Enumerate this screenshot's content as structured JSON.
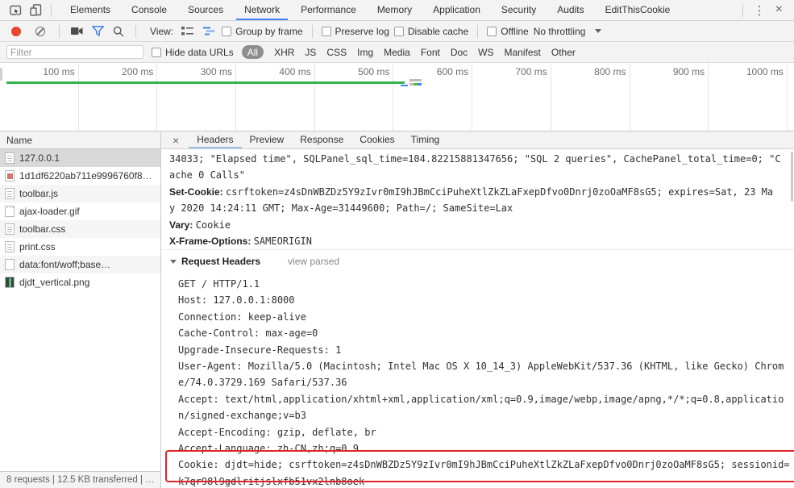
{
  "window": {
    "tabs": [
      "Elements",
      "Console",
      "Sources",
      "Network",
      "Performance",
      "Memory",
      "Application",
      "Security",
      "Audits",
      "EditThisCookie"
    ],
    "active_tab": "Network",
    "more_label": "⋮",
    "close_label": "×"
  },
  "network_toolbar": {
    "view_label": "View:",
    "group_by_frame": "Group by frame",
    "preserve_log": "Preserve log",
    "disable_cache": "Disable cache",
    "offline": "Offline",
    "throttling": "No throttling"
  },
  "filter_bar": {
    "placeholder": "Filter",
    "hide_data_urls": "Hide data URLs",
    "types": [
      "All",
      "XHR",
      "JS",
      "CSS",
      "Img",
      "Media",
      "Font",
      "Doc",
      "WS",
      "Manifest",
      "Other"
    ],
    "active_type": "All"
  },
  "overview": {
    "ticks": [
      "100 ms",
      "200 ms",
      "300 ms",
      "400 ms",
      "500 ms",
      "600 ms",
      "700 ms",
      "800 ms",
      "900 ms",
      "1000 ms"
    ]
  },
  "request_list": {
    "column_header": "Name",
    "rows": [
      {
        "name": "127.0.0.1",
        "icon": "doc",
        "selected": true
      },
      {
        "name": "1d1df6220ab711e9996760f8…",
        "icon": "img",
        "selected": false
      },
      {
        "name": "toolbar.js",
        "icon": "doc",
        "selected": false
      },
      {
        "name": "ajax-loader.gif",
        "icon": "img-dots",
        "selected": false
      },
      {
        "name": "toolbar.css",
        "icon": "doc",
        "selected": false
      },
      {
        "name": "print.css",
        "icon": "doc",
        "selected": false
      },
      {
        "name": "data:font/woff;base…",
        "icon": "blank",
        "selected": false
      },
      {
        "name": "djdt_vertical.png",
        "icon": "img-green",
        "selected": false
      }
    ]
  },
  "detail_pane": {
    "close_label": "×",
    "tabs": [
      "Headers",
      "Preview",
      "Response",
      "Cookies",
      "Timing"
    ],
    "active_tab": "Headers",
    "response_tail_lines": [
      [
        {
          "b": false,
          "t": "34033; \"Elapsed time\", SQLPanel_sql_time=104.82215881347656; \"SQL 2 queries\", CachePanel_total_time=0; \"C"
        }
      ],
      [
        {
          "b": false,
          "t": "ache 0 Calls\""
        }
      ],
      [
        {
          "b": true,
          "t": "Set-Cookie: "
        },
        {
          "b": false,
          "t": "csrftoken=z4sDnWBZDz5Y9zIvr0mI9hJBmCciPuheXtlZkZLaFxepDfvo0Dnrj0zoOaMF8sG5; expires=Sat, 23 Ma"
        }
      ],
      [
        {
          "b": false,
          "t": "y 2020 14:24:11 GMT; Max-Age=31449600; Path=/; SameSite=Lax"
        }
      ],
      [
        {
          "b": true,
          "t": "Vary: "
        },
        {
          "b": false,
          "t": "Cookie"
        }
      ],
      [
        {
          "b": true,
          "t": "X-Frame-Options: "
        },
        {
          "b": false,
          "t": "SAMEORIGIN"
        }
      ]
    ],
    "request_headers_section": {
      "title": "Request Headers",
      "toggle_link": "view parsed",
      "lines": [
        "GET / HTTP/1.1",
        "Host: 127.0.0.1:8000",
        "Connection: keep-alive",
        "Cache-Control: max-age=0",
        "Upgrade-Insecure-Requests: 1",
        "User-Agent: Mozilla/5.0 (Macintosh; Intel Mac OS X 10_14_3) AppleWebKit/537.36 (KHTML, like Gecko) Chrom",
        "e/74.0.3729.169 Safari/537.36",
        "Accept: text/html,application/xhtml+xml,application/xml;q=0.9,image/webp,image/apng,*/*;q=0.8,applicatio",
        "n/signed-exchange;v=b3",
        "Accept-Encoding: gzip, deflate, br",
        "Accept-Language: zh-CN,zh;q=0.9",
        "Cookie: djdt=hide; csrftoken=z4sDnWBZDz5Y9zIvr0mI9hJBmCciPuheXtlZkZLaFxepDfvo0Dnrj0zoOaMF8sG5; sessionid=",
        "k7qr98l9gdlritjslxfb51vx2lnb8oek"
      ],
      "highlight_color": "#e02424"
    }
  },
  "status_bar": {
    "text": "8 requests | 12.5 KB transferred | …"
  }
}
